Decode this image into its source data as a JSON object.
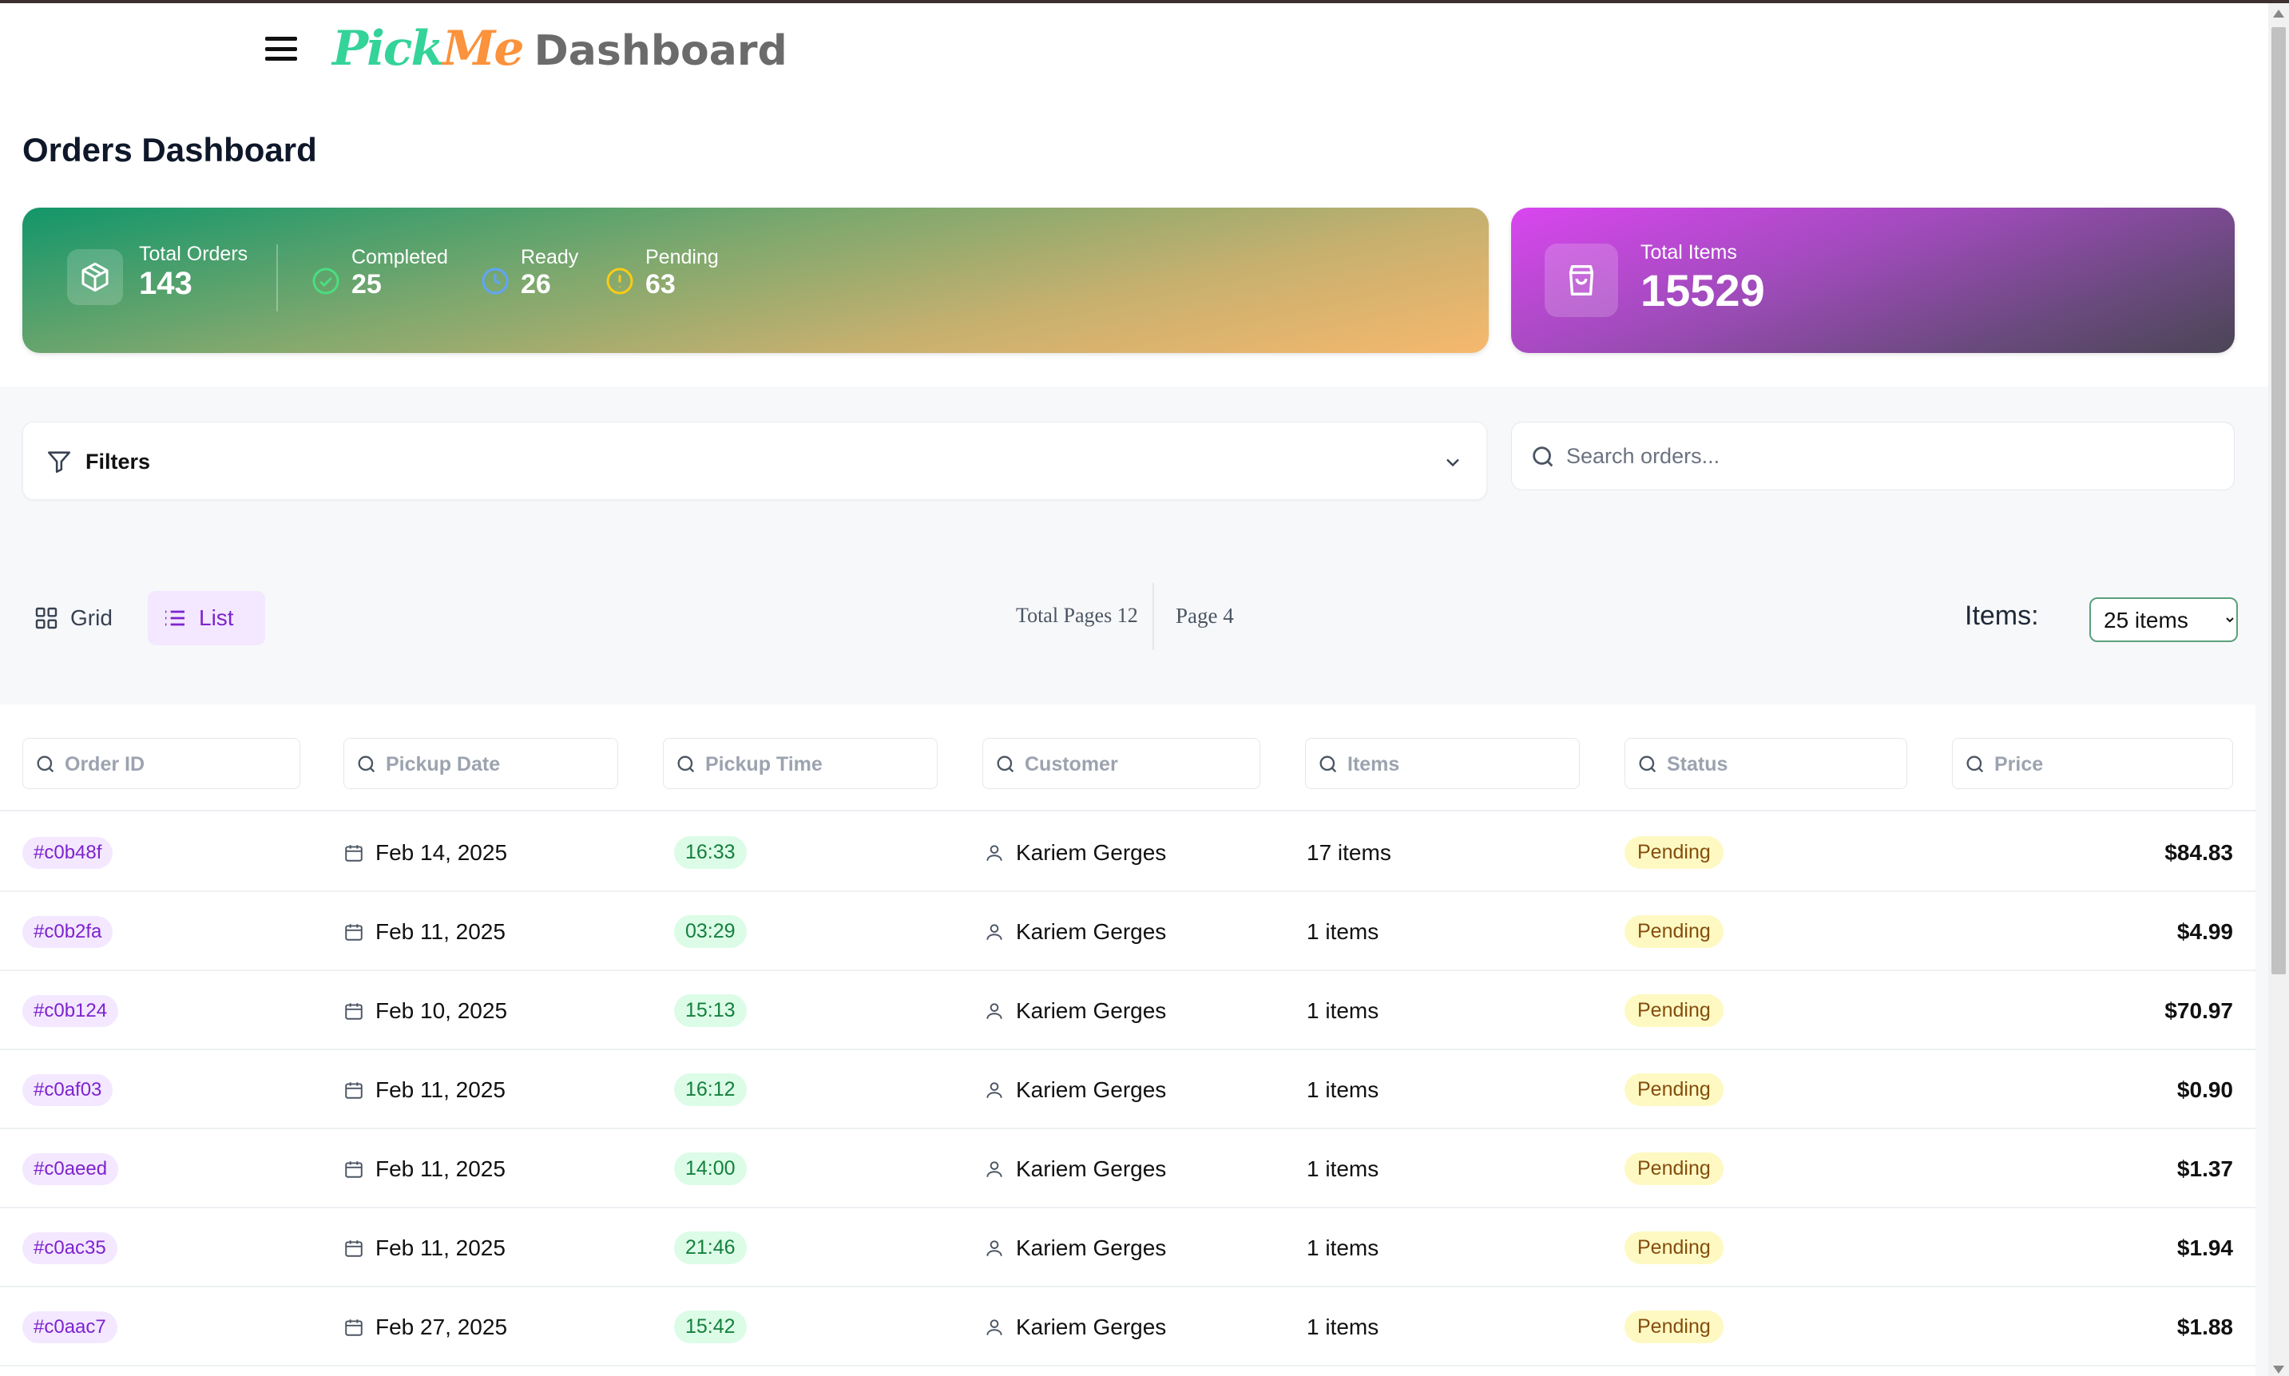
{
  "brand": {
    "pick": "Pick",
    "me": "Me",
    "dashboard": "Dashboard"
  },
  "page_title": "Orders Dashboard",
  "stats": {
    "total_orders_label": "Total Orders",
    "total_orders": "143",
    "completed_label": "Completed",
    "completed": "25",
    "ready_label": "Ready",
    "ready": "26",
    "pending_label": "Pending",
    "pending": "63",
    "total_items_label": "Total Items",
    "total_items": "15529"
  },
  "filters": {
    "label": "Filters"
  },
  "search": {
    "placeholder": "Search orders..."
  },
  "view": {
    "grid_label": "Grid",
    "list_label": "List",
    "active": "list"
  },
  "pagination": {
    "total_pages": "Total Pages 12",
    "page": "Page 4"
  },
  "page_size": {
    "label": "Items:",
    "selected": "25 items"
  },
  "columns": {
    "order_id": "Order ID",
    "pickup_date": "Pickup Date",
    "pickup_time": "Pickup Time",
    "customer": "Customer",
    "items": "Items",
    "status": "Status",
    "price": "Price"
  },
  "orders": [
    {
      "id": "#c0b48f",
      "date": "Feb 14, 2025",
      "time": "16:33",
      "customer": "Kariem Gerges",
      "items": "17 items",
      "status": "Pending",
      "price": "$84.83"
    },
    {
      "id": "#c0b2fa",
      "date": "Feb 11, 2025",
      "time": "03:29",
      "customer": "Kariem Gerges",
      "items": "1 items",
      "status": "Pending",
      "price": "$4.99"
    },
    {
      "id": "#c0b124",
      "date": "Feb 10, 2025",
      "time": "15:13",
      "customer": "Kariem Gerges",
      "items": "1 items",
      "status": "Pending",
      "price": "$70.97"
    },
    {
      "id": "#c0af03",
      "date": "Feb 11, 2025",
      "time": "16:12",
      "customer": "Kariem Gerges",
      "items": "1 items",
      "status": "Pending",
      "price": "$0.90"
    },
    {
      "id": "#c0aeed",
      "date": "Feb 11, 2025",
      "time": "14:00",
      "customer": "Kariem Gerges",
      "items": "1 items",
      "status": "Pending",
      "price": "$1.37"
    },
    {
      "id": "#c0ac35",
      "date": "Feb 11, 2025",
      "time": "21:46",
      "customer": "Kariem Gerges",
      "items": "1 items",
      "status": "Pending",
      "price": "$1.94"
    },
    {
      "id": "#c0aac7",
      "date": "Feb 27, 2025",
      "time": "15:42",
      "customer": "Kariem Gerges",
      "items": "1 items",
      "status": "Pending",
      "price": "$1.88"
    }
  ],
  "colors": {
    "brand_green": "#34d399",
    "brand_orange": "#fb923c",
    "accent_purple": "#7e22ce",
    "pending": "#fef9c3"
  }
}
